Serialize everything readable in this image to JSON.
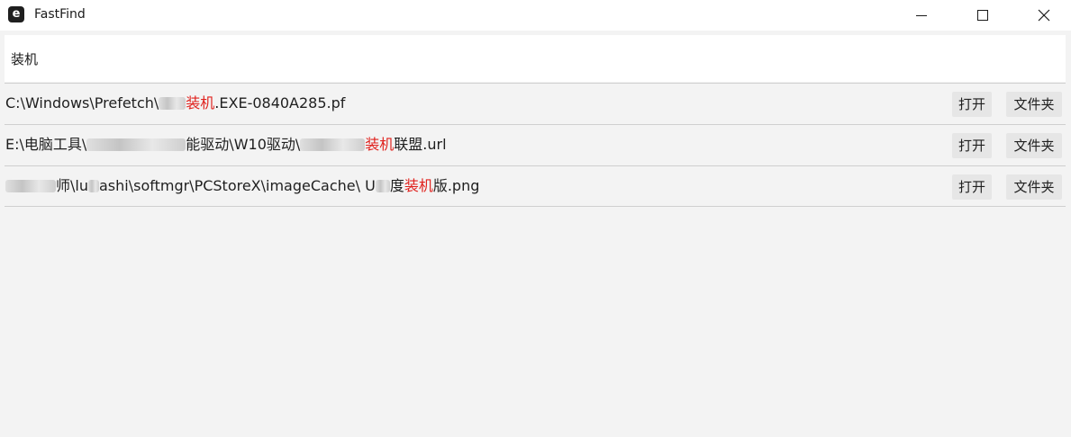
{
  "window": {
    "title": "FastFind",
    "icon_letter": "e",
    "controls": [
      "minimize-icon",
      "maximize-icon",
      "close-icon"
    ]
  },
  "search": {
    "value": "装机",
    "placeholder": ""
  },
  "highlight_color": "#e0221e",
  "results": [
    {
      "path_before": "C:\\Windows\\Prefetch\\",
      "redacted_before": "",
      "path_mid": "",
      "match": "装机",
      "path_after": ".EXE-0840A285.pf",
      "open_label": "打开",
      "folder_label": "文件夹"
    },
    {
      "path_before": "E:\\电脑工具\\",
      "path_mid": "能驱动\\W10驱动\\",
      "match": "装机",
      "path_after": "联盟.url",
      "open_label": "打开",
      "folder_label": "文件夹"
    },
    {
      "path_before": "",
      "path_mid": "师\\lu",
      "path_mid2": "ashi\\softmgr\\PCStoreX\\imageCache\\ U",
      "path_mid3": "度",
      "match": "装机",
      "path_after": "版.png",
      "open_label": "打开",
      "folder_label": "文件夹"
    }
  ]
}
